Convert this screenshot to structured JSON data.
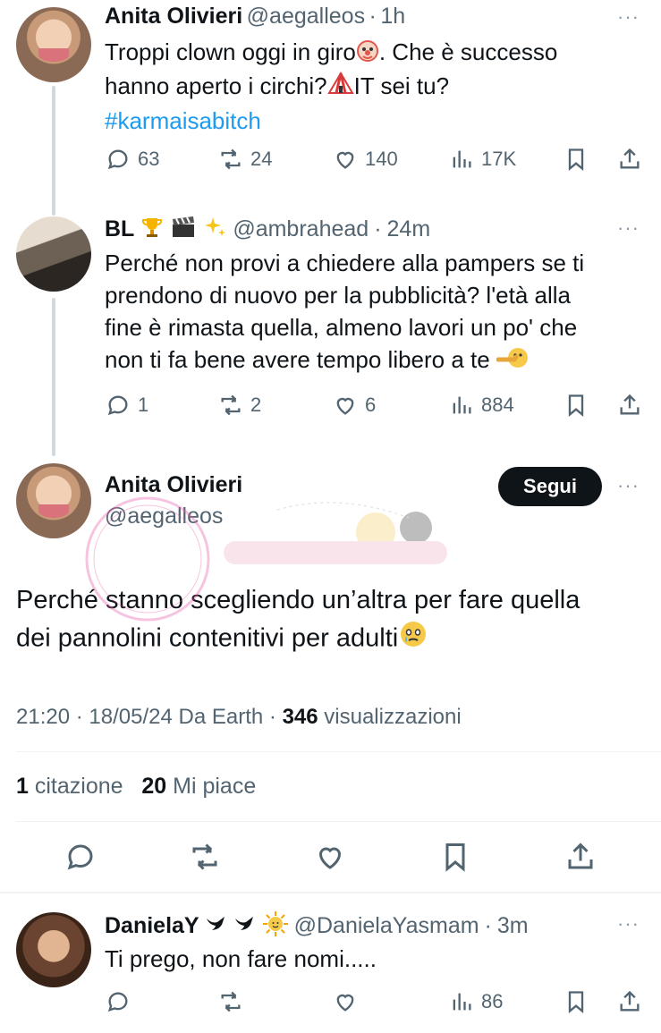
{
  "tweet1": {
    "name": "Anita Olivieri",
    "handle": "@aegalleos",
    "dot": "·",
    "time": "1h",
    "text_line1": "Troppi clown oggi in giro",
    "text_line1b": ". Che è successo",
    "text_line2a": "hanno aperto i circhi?",
    "text_line2b": "IT sei tu?",
    "hashtag": "#karmaisabitch",
    "replies": "63",
    "retweets": "24",
    "likes": "140",
    "views": "17K"
  },
  "tweet2": {
    "name": "BL",
    "handle": "@ambrahead",
    "dot": "·",
    "time": "24m",
    "line1": "Perché non provi a chiedere alla pampers se ti",
    "line2": "prendono di nuovo per la pubblicità? l'età alla",
    "line3": "fine è rimasta quella, almeno lavori un po' che",
    "line4": "non ti fa bene avere tempo libero a te",
    "replies": "1",
    "retweets": "2",
    "likes": "6",
    "views": "884"
  },
  "main_tweet": {
    "name": "Anita Olivieri",
    "handle": "@aegalleos",
    "follow_label": "Segui",
    "line1": "Perché stanno scegliendo un’altra per fare quella",
    "line2": "dei pannolini contenitivi per adulti",
    "time": "21:20",
    "date": "18/05/24",
    "source": "Da Earth",
    "views_count": "346",
    "views_label": "visualizzazioni",
    "quotes_count": "1",
    "quotes_label": "citazione",
    "likes_count": "20",
    "likes_label": "Mi piace",
    "sep": "·"
  },
  "tweet3": {
    "name": "DanielaY",
    "handle": "@DanielaYasmam",
    "dot": "·",
    "time": "3m",
    "text": "Ti prego, non fare nomi.....",
    "views": "86"
  },
  "more_glyph": "···",
  "colors": {
    "text": "#0f1419",
    "muted": "#536471",
    "link": "#1d9bf0",
    "line": "#cfd9de"
  }
}
